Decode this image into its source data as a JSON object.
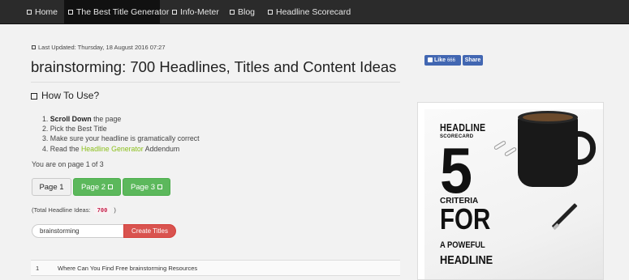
{
  "nav": {
    "items": [
      {
        "label": "Home"
      },
      {
        "label": "The Best Title Generator"
      },
      {
        "label": "Info-Meter"
      },
      {
        "label": "Blog"
      },
      {
        "label": "Headline Scorecard"
      }
    ]
  },
  "meta": {
    "last_updated": "Last Updated: Thursday, 18 August 2016 07:27"
  },
  "social": {
    "like_label": "Like",
    "like_count": "666",
    "share_label": "Share"
  },
  "page": {
    "title": "brainstorming: 700 Headlines, Titles and Content Ideas",
    "how_heading": "How To Use?"
  },
  "steps": {
    "s1_bold": "Scroll Down",
    "s1_rest": " the page",
    "s2": "Pick the Best Title",
    "s3": "Make sure your headline is gramatically correct",
    "s4_pre": "Read the ",
    "s4_link": "Headline Generator",
    "s4_post": " Addendum"
  },
  "pagination": {
    "info": "You are on page 1 of 3",
    "buttons": [
      {
        "label": "Page 1"
      },
      {
        "label": "Page 2"
      },
      {
        "label": "Page 3"
      }
    ]
  },
  "totals": {
    "prefix": "(Total Headline Ideas:",
    "count": "700",
    "suffix": ")"
  },
  "search": {
    "value": "brainstorming",
    "button_label": "Create Titles"
  },
  "results": [
    {
      "num": "1",
      "text": "Where Can You Find Free brainstorming Resources"
    }
  ],
  "colors": {
    "accent_green": "#5cb85c",
    "link_green": "#8bbf1b",
    "create_red": "#d9534f",
    "facebook_blue": "#4267b2"
  },
  "promo": {
    "line1": "HEADLINE",
    "line2": "SCORECARD",
    "line3": "5",
    "line4": "CRITERIA",
    "line5": "FOR",
    "line6": "A POWEFUL",
    "line7": "HEADLINE"
  }
}
